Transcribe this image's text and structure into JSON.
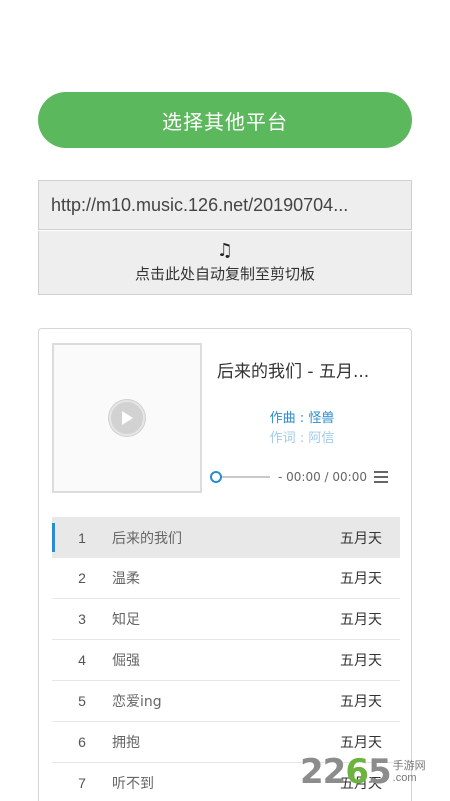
{
  "platform_button": {
    "label": "选择其他平台"
  },
  "url_box": {
    "value": "http://m10.music.126.net/20190704..."
  },
  "copy_button": {
    "icon": "music-note-icon",
    "note_glyph": "♫",
    "label": "点击此处自动复制至剪切板"
  },
  "player": {
    "title": "后来的我们 - 五月...",
    "composer": "作曲 : 怪兽",
    "lyricist": "作词 : 阿信",
    "time": "- 00:00 / 00:00",
    "accent_color": "#2a8bd1"
  },
  "playlist": [
    {
      "num": "1",
      "name": "后来的我们",
      "artist": "五月天"
    },
    {
      "num": "2",
      "name": "温柔",
      "artist": "五月天"
    },
    {
      "num": "3",
      "name": "知足",
      "artist": "五月天"
    },
    {
      "num": "4",
      "name": "倔强",
      "artist": "五月天"
    },
    {
      "num": "5",
      "name": "恋爱ing",
      "artist": "五月天"
    },
    {
      "num": "6",
      "name": "拥抱",
      "artist": "五月天"
    },
    {
      "num": "7",
      "name": "听不到",
      "artist": "五月天"
    }
  ],
  "watermark": {
    "number_a": "22",
    "number_b": "6",
    "number_c": "5",
    "cn": "手游网",
    "domain": ".com"
  },
  "colors": {
    "primary_green": "#5cb85c",
    "accent_blue": "#2a8bd1"
  }
}
